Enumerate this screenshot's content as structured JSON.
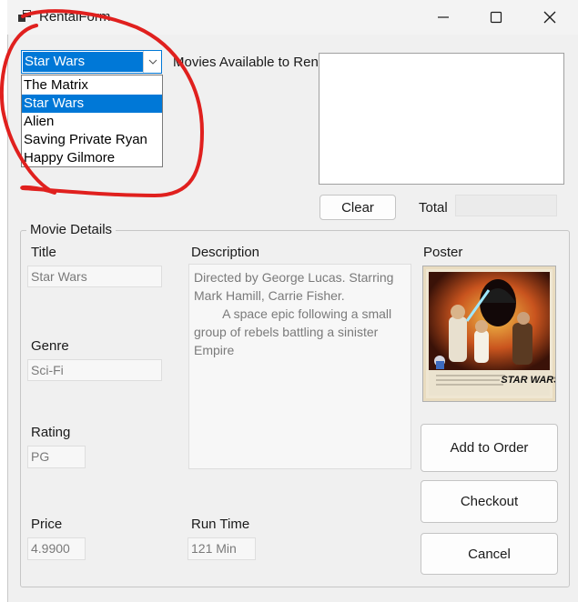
{
  "window": {
    "title": "RentalForm",
    "app_icon": "app-window-icon",
    "minimize_icon": "minimize-icon",
    "maximize_icon": "maximize-icon",
    "close_icon": "close-icon"
  },
  "movie_combo": {
    "selected": "Star Wars",
    "arrow_icon": "chevron-down-icon",
    "options": [
      "The Matrix",
      "Star Wars",
      "Alien",
      "Saving Private Ryan",
      "Happy Gilmore"
    ],
    "selected_index": 1
  },
  "available_label": "Movies Available to Ren",
  "clear_button": "Clear",
  "total_label": "Total",
  "total_value": "",
  "details": {
    "group_title": "Movie Details",
    "title_label": "Title",
    "title_value": "Star Wars",
    "genre_label": "Genre",
    "genre_value": "Sci-Fi",
    "rating_label": "Rating",
    "rating_value": "PG",
    "price_label": "Price",
    "price_value": "4.9900",
    "description_label": "Description",
    "description_value": "Directed by George Lucas. Starring Mark Hamill, Carrie Fisher.\n        A space epic following a small group of rebels battling a sinister Empire",
    "runtime_label": "Run Time",
    "runtime_value": "121 Min",
    "poster_label": "Poster",
    "poster_logo": "STAR WARS"
  },
  "buttons": {
    "add_to_order": "Add to Order",
    "checkout": "Checkout",
    "cancel": "Cancel"
  },
  "annotation_color": "#e0201e",
  "accent_color": "#0078d7"
}
